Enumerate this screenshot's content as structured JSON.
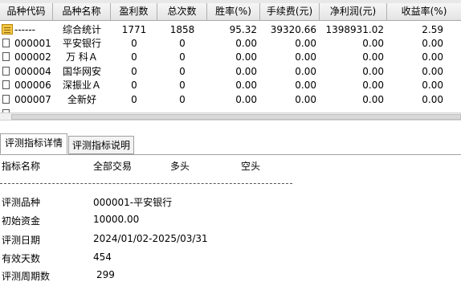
{
  "table": {
    "columns": [
      "品种代码",
      "品种名称",
      "盈利数",
      "总次数",
      "胜率(%)",
      "手续费(元)",
      "净利润(元)",
      "收益率(%)"
    ],
    "rows": [
      {
        "code": "------",
        "name": "综合统计",
        "profit_count": "1771",
        "total_count": "1858",
        "win_rate": "95.32",
        "fee": "39320.66",
        "net_profit": "1398931.02",
        "return_rate": "2.59",
        "icon": "folder-icon"
      },
      {
        "code": "000001",
        "name": "平安银行",
        "profit_count": "0",
        "total_count": "0",
        "win_rate": "0.00",
        "fee": "0.00",
        "net_profit": "0.00",
        "return_rate": "0.00",
        "icon": "item-box-icon"
      },
      {
        "code": "000002",
        "name": "万 科Ａ",
        "profit_count": "0",
        "total_count": "0",
        "win_rate": "0.00",
        "fee": "0.00",
        "net_profit": "0.00",
        "return_rate": "0.00",
        "icon": "item-box-icon"
      },
      {
        "code": "000004",
        "name": "国华网安",
        "profit_count": "0",
        "total_count": "0",
        "win_rate": "0.00",
        "fee": "0.00",
        "net_profit": "0.00",
        "return_rate": "0.00",
        "icon": "item-box-icon"
      },
      {
        "code": "000006",
        "name": "深振业Ａ",
        "profit_count": "0",
        "total_count": "0",
        "win_rate": "0.00",
        "fee": "0.00",
        "net_profit": "0.00",
        "return_rate": "0.00",
        "icon": "item-box-icon"
      },
      {
        "code": "000007",
        "name": "全新好",
        "profit_count": "0",
        "total_count": "0",
        "win_rate": "0.00",
        "fee": "0.00",
        "net_profit": "0.00",
        "return_rate": "0.00",
        "icon": "item-box-icon"
      }
    ]
  },
  "tabs": [
    {
      "label": "评测指标详情",
      "active": true
    },
    {
      "label": "评测指标说明",
      "active": false
    }
  ],
  "detail": {
    "header": {
      "name_label": "指标名称",
      "all_label": "全部交易",
      "long_label": "多头",
      "short_label": "空头"
    },
    "items": [
      {
        "label": "评测品种",
        "value": "000001-平安银行"
      },
      {
        "label": "初始资金",
        "value": "10000.00"
      },
      {
        "label": "评测日期",
        "value": "2024/01/02-2025/03/31"
      },
      {
        "label": "有效天数",
        "value": "454"
      },
      {
        "label": "评测周期数",
        "value": "299"
      }
    ]
  },
  "colors": {
    "header_bg": "#e8e8e8",
    "folder": "#f2c744"
  }
}
